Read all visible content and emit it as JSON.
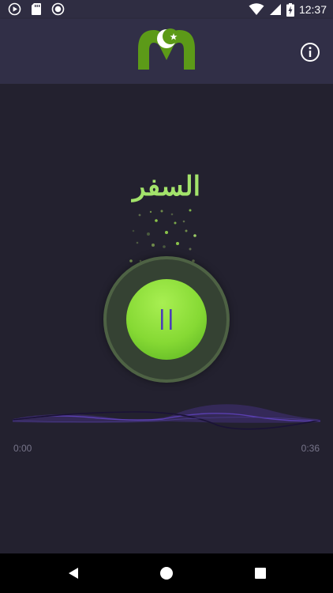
{
  "status_bar": {
    "time": "12:37",
    "icons_left": [
      "play-circle-icon",
      "sd-card-icon",
      "record-icon"
    ],
    "icons_right": [
      "wifi-icon",
      "signal-icon",
      "battery-charging-icon"
    ]
  },
  "app_bar": {
    "logo": "crescent-star-m-logo",
    "info_icon": "info-icon"
  },
  "player": {
    "title": "السفر",
    "state": "playing",
    "time_elapsed": "0:00",
    "time_total": "0:36",
    "progress": 0
  },
  "colors": {
    "accent_green": "#8ad93a",
    "title_green": "#a3e36b",
    "background": "#23212f",
    "app_bar": "#312f47"
  },
  "nav": {
    "icons": [
      "back-icon",
      "home-icon",
      "recents-icon"
    ]
  }
}
